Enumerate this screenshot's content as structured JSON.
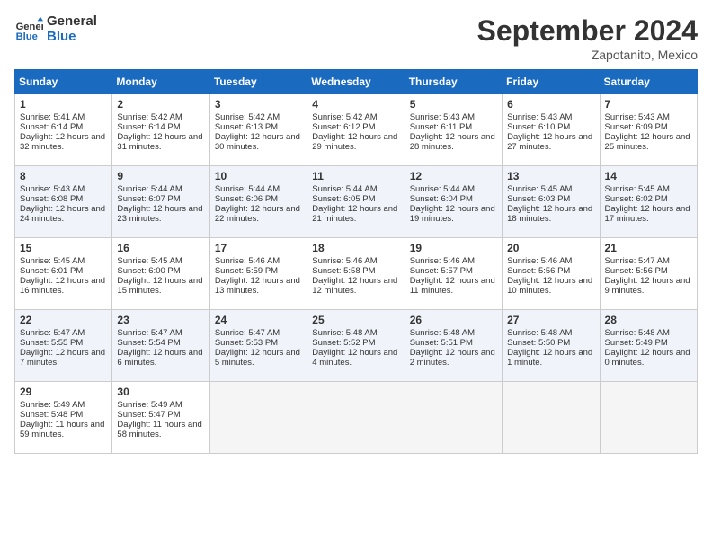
{
  "header": {
    "logo_line1": "General",
    "logo_line2": "Blue",
    "month_year": "September 2024",
    "location": "Zapotanito, Mexico"
  },
  "weekdays": [
    "Sunday",
    "Monday",
    "Tuesday",
    "Wednesday",
    "Thursday",
    "Friday",
    "Saturday"
  ],
  "weeks": [
    [
      {
        "day": "1",
        "sunrise": "5:41 AM",
        "sunset": "6:14 PM",
        "daylight": "12 hours and 32 minutes."
      },
      {
        "day": "2",
        "sunrise": "5:42 AM",
        "sunset": "6:14 PM",
        "daylight": "12 hours and 31 minutes."
      },
      {
        "day": "3",
        "sunrise": "5:42 AM",
        "sunset": "6:13 PM",
        "daylight": "12 hours and 30 minutes."
      },
      {
        "day": "4",
        "sunrise": "5:42 AM",
        "sunset": "6:12 PM",
        "daylight": "12 hours and 29 minutes."
      },
      {
        "day": "5",
        "sunrise": "5:43 AM",
        "sunset": "6:11 PM",
        "daylight": "12 hours and 28 minutes."
      },
      {
        "day": "6",
        "sunrise": "5:43 AM",
        "sunset": "6:10 PM",
        "daylight": "12 hours and 27 minutes."
      },
      {
        "day": "7",
        "sunrise": "5:43 AM",
        "sunset": "6:09 PM",
        "daylight": "12 hours and 25 minutes."
      }
    ],
    [
      {
        "day": "8",
        "sunrise": "5:43 AM",
        "sunset": "6:08 PM",
        "daylight": "12 hours and 24 minutes."
      },
      {
        "day": "9",
        "sunrise": "5:44 AM",
        "sunset": "6:07 PM",
        "daylight": "12 hours and 23 minutes."
      },
      {
        "day": "10",
        "sunrise": "5:44 AM",
        "sunset": "6:06 PM",
        "daylight": "12 hours and 22 minutes."
      },
      {
        "day": "11",
        "sunrise": "5:44 AM",
        "sunset": "6:05 PM",
        "daylight": "12 hours and 21 minutes."
      },
      {
        "day": "12",
        "sunrise": "5:44 AM",
        "sunset": "6:04 PM",
        "daylight": "12 hours and 19 minutes."
      },
      {
        "day": "13",
        "sunrise": "5:45 AM",
        "sunset": "6:03 PM",
        "daylight": "12 hours and 18 minutes."
      },
      {
        "day": "14",
        "sunrise": "5:45 AM",
        "sunset": "6:02 PM",
        "daylight": "12 hours and 17 minutes."
      }
    ],
    [
      {
        "day": "15",
        "sunrise": "5:45 AM",
        "sunset": "6:01 PM",
        "daylight": "12 hours and 16 minutes."
      },
      {
        "day": "16",
        "sunrise": "5:45 AM",
        "sunset": "6:00 PM",
        "daylight": "12 hours and 15 minutes."
      },
      {
        "day": "17",
        "sunrise": "5:46 AM",
        "sunset": "5:59 PM",
        "daylight": "12 hours and 13 minutes."
      },
      {
        "day": "18",
        "sunrise": "5:46 AM",
        "sunset": "5:58 PM",
        "daylight": "12 hours and 12 minutes."
      },
      {
        "day": "19",
        "sunrise": "5:46 AM",
        "sunset": "5:57 PM",
        "daylight": "12 hours and 11 minutes."
      },
      {
        "day": "20",
        "sunrise": "5:46 AM",
        "sunset": "5:56 PM",
        "daylight": "12 hours and 10 minutes."
      },
      {
        "day": "21",
        "sunrise": "5:47 AM",
        "sunset": "5:56 PM",
        "daylight": "12 hours and 9 minutes."
      }
    ],
    [
      {
        "day": "22",
        "sunrise": "5:47 AM",
        "sunset": "5:55 PM",
        "daylight": "12 hours and 7 minutes."
      },
      {
        "day": "23",
        "sunrise": "5:47 AM",
        "sunset": "5:54 PM",
        "daylight": "12 hours and 6 minutes."
      },
      {
        "day": "24",
        "sunrise": "5:47 AM",
        "sunset": "5:53 PM",
        "daylight": "12 hours and 5 minutes."
      },
      {
        "day": "25",
        "sunrise": "5:48 AM",
        "sunset": "5:52 PM",
        "daylight": "12 hours and 4 minutes."
      },
      {
        "day": "26",
        "sunrise": "5:48 AM",
        "sunset": "5:51 PM",
        "daylight": "12 hours and 2 minutes."
      },
      {
        "day": "27",
        "sunrise": "5:48 AM",
        "sunset": "5:50 PM",
        "daylight": "12 hours and 1 minute."
      },
      {
        "day": "28",
        "sunrise": "5:48 AM",
        "sunset": "5:49 PM",
        "daylight": "12 hours and 0 minutes."
      }
    ],
    [
      {
        "day": "29",
        "sunrise": "5:49 AM",
        "sunset": "5:48 PM",
        "daylight": "11 hours and 59 minutes."
      },
      {
        "day": "30",
        "sunrise": "5:49 AM",
        "sunset": "5:47 PM",
        "daylight": "11 hours and 58 minutes."
      },
      null,
      null,
      null,
      null,
      null
    ]
  ]
}
